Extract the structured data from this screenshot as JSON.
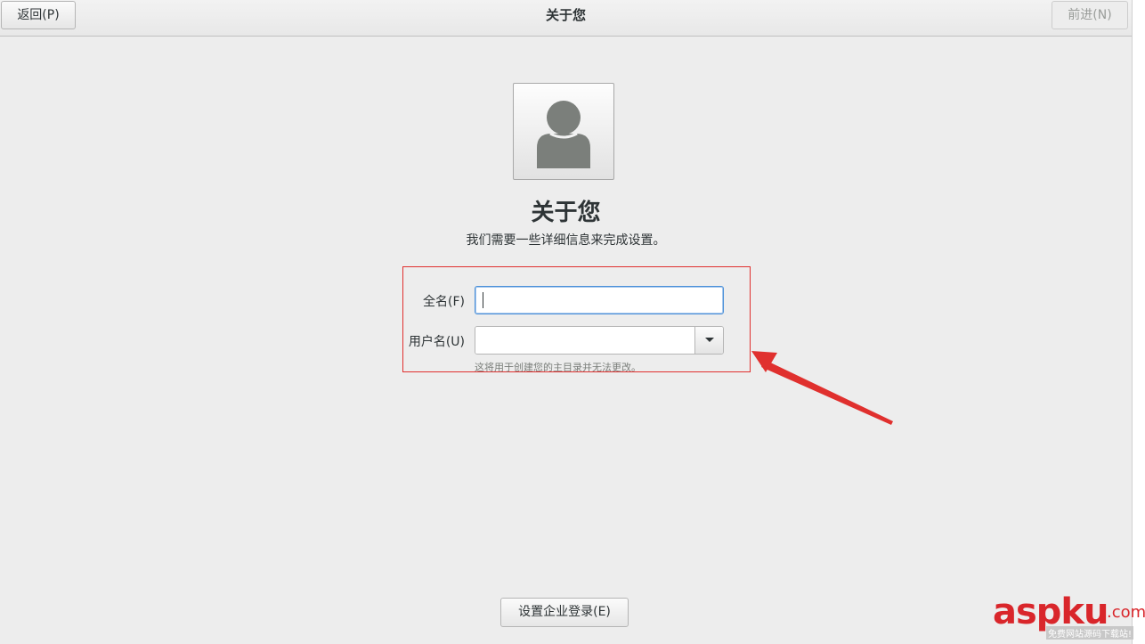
{
  "header": {
    "back_label": "返回(P)",
    "title": "关于您",
    "next_label": "前进(N)"
  },
  "main": {
    "avatar_icon": "user-avatar-icon",
    "title": "关于您",
    "subtitle": "我们需要一些详细信息来完成设置。"
  },
  "form": {
    "fullname_label": "全名(F)",
    "fullname_value": "",
    "username_label": "用户名(U)",
    "username_value": "",
    "hint": "这将用于创建您的主目录并无法更改。"
  },
  "footer": {
    "enterprise_label": "设置企业登录(E)"
  },
  "watermark": {
    "brand": "aspku",
    "dot_com": ".com",
    "tagline": "免费网站源码下载站!"
  },
  "colors": {
    "accent": "#4a90d9",
    "annotation": "#e0302e",
    "background": "#ededed"
  }
}
